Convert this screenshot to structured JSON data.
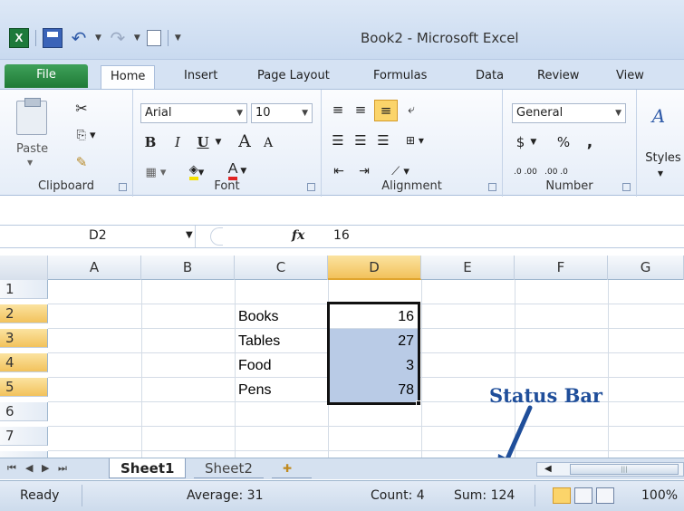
{
  "window": {
    "title": "Book2 - Microsoft Excel"
  },
  "qat": {
    "logo_letter": "X"
  },
  "tabs": [
    "File",
    "Home",
    "Insert",
    "Page Layout",
    "Formulas",
    "Data",
    "Review",
    "View"
  ],
  "ribbon": {
    "clipboard": {
      "label": "Clipboard",
      "paste": "Paste"
    },
    "font": {
      "label": "Font",
      "name": "Arial",
      "size": "10",
      "bold": "B",
      "italic": "I",
      "underline": "U",
      "grow": "A",
      "shrink": "A",
      "color_a": "A"
    },
    "alignment": {
      "label": "Alignment"
    },
    "number": {
      "label": "Number",
      "format": "General",
      "currency": "$",
      "percent": "%",
      "comma": ",",
      "inc_dec": ".0 .00",
      "dec_dec": ".00 .0"
    },
    "styles": {
      "label": "Styles"
    }
  },
  "formula_bar": {
    "name_box": "D2",
    "fx": "fx",
    "value": "16"
  },
  "columns": [
    "A",
    "B",
    "C",
    "D",
    "E",
    "F",
    "G"
  ],
  "rows": [
    "1",
    "2",
    "3",
    "4",
    "5",
    "6",
    "7"
  ],
  "cells": {
    "C2": "Books",
    "C3": "Tables",
    "C4": "Food",
    "C5": "Pens",
    "D2": "16",
    "D3": "27",
    "D4": "3",
    "D5": "78"
  },
  "sheets": [
    "Sheet1",
    "Sheet2"
  ],
  "status": {
    "ready": "Ready",
    "average": "Average: 31",
    "count": "Count: 4",
    "sum": "Sum: 124",
    "zoom": "100%"
  },
  "annotation": {
    "label": "Status Bar"
  },
  "colors": {
    "accent": "#1f4e9a",
    "file_tab": "#2a8a44",
    "selection": "#b9cbe6",
    "header_selected": "#f5c86a"
  }
}
